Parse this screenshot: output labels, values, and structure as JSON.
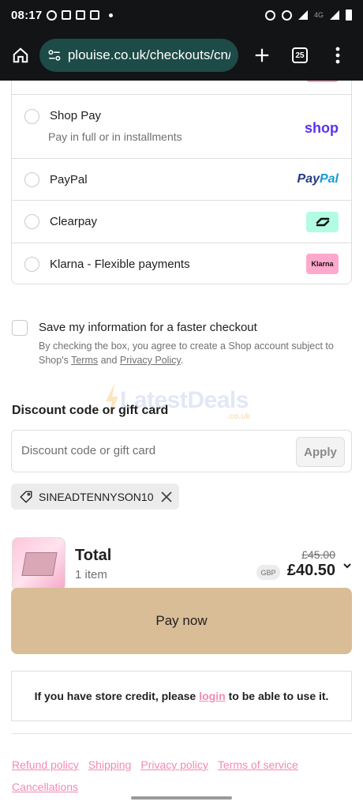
{
  "status_bar": {
    "time": "08:17",
    "network": "4G"
  },
  "browser": {
    "url": "plouise.co.uk/checkouts/cn/",
    "tab_count": "25"
  },
  "payment_methods": [
    {
      "label": "Shop Pay",
      "sub": "Pay in full or in installments",
      "logo": "shop"
    },
    {
      "label": "PayPal",
      "logo_a": "Pay",
      "logo_b": "Pal"
    },
    {
      "label": "Clearpay",
      "logo": "clearpay-icon"
    },
    {
      "label": "Klarna - Flexible payments",
      "logo": "Klarna"
    }
  ],
  "save_info": {
    "title": "Save my information for a faster checkout",
    "desc_pre": "By checking the box, you agree to create a Shop account subject to Shop's ",
    "terms": "Terms",
    "and": " and ",
    "privacy": "Privacy Policy",
    "end": "."
  },
  "watermark": {
    "text": "LatestDeals",
    "sub": ".co.uk"
  },
  "discount": {
    "title": "Discount code or gift card",
    "placeholder": "Discount code or gift card",
    "apply": "Apply",
    "applied_code": "SINEADTENNYSON10"
  },
  "total": {
    "label": "Total",
    "items": "1 item",
    "old_price": "£45.00",
    "currency": "GBP",
    "new_price": "£40.50"
  },
  "pay_now": "Pay now",
  "store_credit": {
    "pre": "If you have store credit, please",
    "link": "login",
    "post": "to be able to use it."
  },
  "footer": [
    "Refund policy",
    "Shipping",
    "Privacy policy",
    "Terms of service",
    "Cancellations"
  ],
  "colors": {
    "accent_pink": "#f28ab5",
    "pay_button": "#d9bd96",
    "shop_purple": "#5a31f4"
  }
}
